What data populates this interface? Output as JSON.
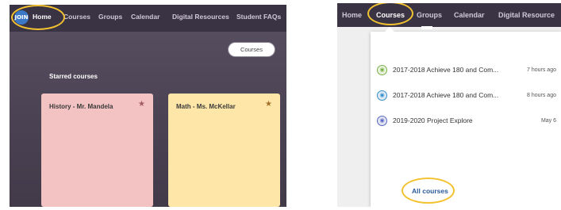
{
  "left": {
    "logo": "JOIN",
    "nav": [
      "Home",
      "Courses",
      "Groups",
      "Calendar",
      "Digital Resources",
      "Student FAQs"
    ],
    "courses_button": "Courses",
    "section_title": "Starred courses",
    "cards": [
      {
        "title": "History - Mr. Mandela",
        "star": "★",
        "color": "#f3c2c2"
      },
      {
        "title": "Math - Ms. McKellar",
        "star": "★",
        "color": "#fde6a8"
      }
    ]
  },
  "right": {
    "nav": [
      "Home",
      "Courses",
      "Groups",
      "Calendar",
      "Digital Resource"
    ],
    "dropdown_items": [
      {
        "name": "2017-2018 Achieve 180 and Com...",
        "time": "7 hours ago",
        "icon_color": "#7bb14a"
      },
      {
        "name": "2017-2018 Achieve 180 and Com...",
        "time": "8 hours ago",
        "icon_color": "#3a8fc8"
      },
      {
        "name": "2019-2020 Project Explore",
        "time": "May 6",
        "icon_color": "#5a6ac0"
      }
    ],
    "all_courses": "All courses"
  },
  "colors": {
    "highlight": "#f2c230",
    "navbar": "#3a3344",
    "link": "#2a5b9a"
  }
}
